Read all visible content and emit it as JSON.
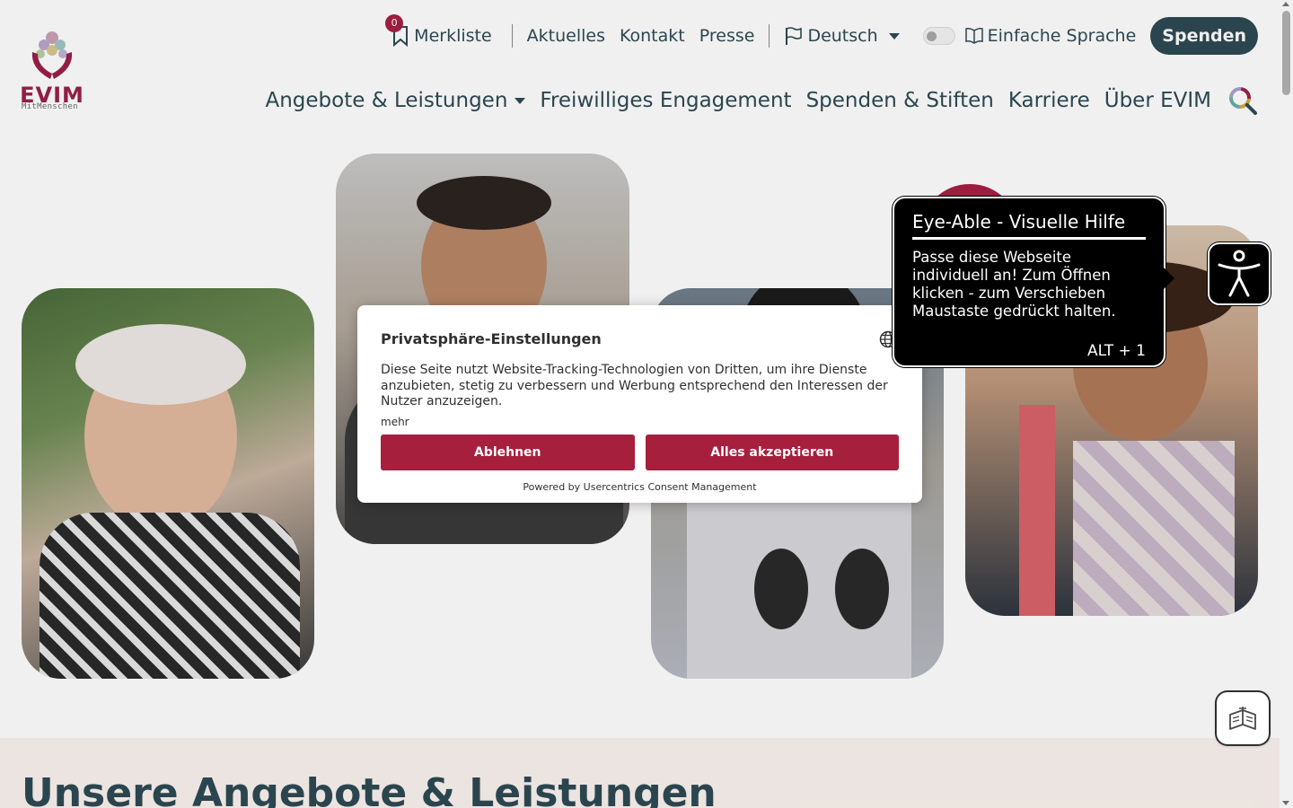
{
  "brand": {
    "name": "EVIM",
    "tagline": "MitMenschen",
    "colors": {
      "primary": "#2e4a54",
      "accent": "#a61f45"
    }
  },
  "topbar": {
    "bookmark_count": "0",
    "bookmark_label": "Merkliste",
    "links": [
      "Aktuelles",
      "Kontakt",
      "Presse"
    ],
    "language": "Deutsch",
    "easy_language": "Einfache Sprache",
    "donate_button": "Spenden"
  },
  "mainnav": {
    "items": [
      "Angebote & Leistungen",
      "Freiwilliges Engagement",
      "Spenden & Stiften",
      "Karriere",
      "Über EVIM"
    ]
  },
  "section": {
    "title": "Unsere Angebote & Leistungen"
  },
  "consent": {
    "title": "Privatsphäre-Einstellungen",
    "text": "Diese Seite nutzt Website-Tracking-Technologien von Dritten, um ihre Dienste anzubieten, stetig zu verbessern und Werbung entsprechend den Interessen der Nutzer anzuzeigen.",
    "more": "mehr",
    "decline": "Ablehnen",
    "accept": "Alles akzeptieren",
    "powered": "Powered by Usercentrics Consent Management",
    "colors": {
      "button": "#a61f3d"
    }
  },
  "eyeable": {
    "title": "Eye-Able - Visuelle Hilfe",
    "text": "Passe diese Webseite individuell an! Zum Öffnen klicken - zum Verschieben Maustaste gedrückt halten.",
    "shortcut": "ALT + 1"
  },
  "icons": {
    "bookmark": "bookmark-icon",
    "flag": "flag-icon",
    "book": "book-icon",
    "search": "search-icon",
    "globe": "globe-icon",
    "accessibility": "accessibility-icon",
    "reader": "reader-icon"
  }
}
